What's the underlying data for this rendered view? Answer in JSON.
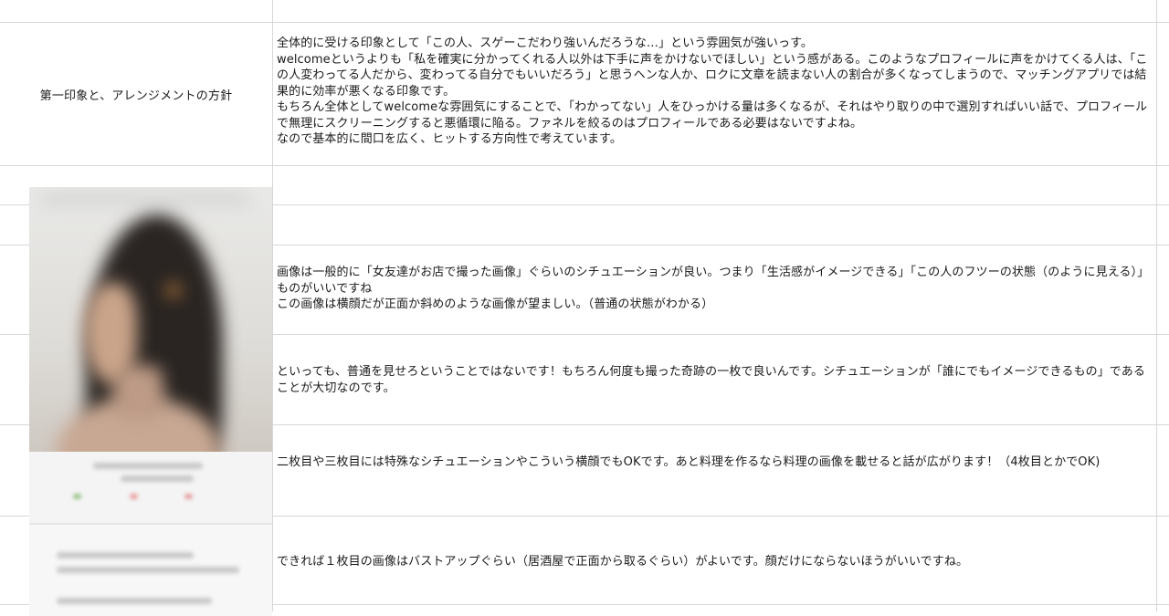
{
  "row_label": "第一印象と、アレンジメントの方針",
  "cells": {
    "first_impression": "全体的に受ける印象として「この人、スゲーこだわり強いんだろうな…」という雰囲気が強いっす。\nwelcomeというよりも「私を確実に分かってくれる人以外は下手に声をかけないでほしい」という感がある。このようなプロフィールに声をかけてくる人は、「この人変わってる人だから、変わってる自分でもいいだろう」と思うヘンな人か、ロクに文章を読まない人の割合が多くなってしまうので、マッチングアプリでは結果的に効率が悪くなる印象です。\nもちろん全体としてwelcomeな雰囲気にすることで、「わかってない」人をひっかける量は多くなるが、それはやり取りの中で選別すればいい話で、プロフィールで無理にスクリーニングすると悪循環に陥る。ファネルを絞るのはプロフィールである必要はないですよね。\nなので基本的に間口を広く、ヒットする方向性で考えています。",
    "image_situation": "画像は一般的に「女友達がお店で撮った画像」ぐらいのシチュエーションが良い。つまり「生活感がイメージできる」「この人のフツーの状態（のように見える）」ものがいいですね\nこの画像は横顔だが正面か斜めのような画像が望ましい。（普通の状態がわかる）",
    "not_ordinary": "といっても、普通を見せろということではないです！もちろん何度も撮った奇跡の一枚で良いんです。シチュエーションが「誰にでもイメージできるもの」であることが大切なのです。",
    "second_third": "二枚目や三枚目には特殊なシチュエーションやこういう横顔でもOKです。あと料理を作るなら料理の画像を載せると話が広がります！（4枚目とかでOK)",
    "first_image": "できれば１枚目の画像はバストアップぐらい（居酒屋で正面から取るぐらい）がよいです。顔だけにならないほうがいいですね。"
  },
  "image": {
    "description_icon": "blurred-profile-photo-icon"
  },
  "colors": {
    "gridline": "#d7d7d7",
    "text": "#1a1a1a",
    "hair": "#2a2522"
  }
}
